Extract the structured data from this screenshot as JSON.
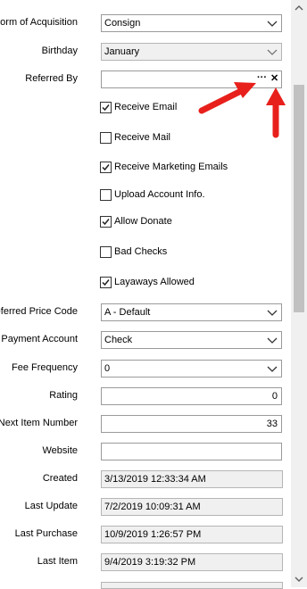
{
  "form": {
    "acquisition": {
      "label": "Form of Acquisition",
      "value": "Consign"
    },
    "birthday": {
      "label": "Birthday",
      "value": "January"
    },
    "referred_by": {
      "label": "Referred By",
      "value": "",
      "browse_label": "···",
      "clear_label": "✕"
    },
    "checkboxes": [
      {
        "label": "Receive Email",
        "checked": true
      },
      {
        "label": "Receive Mail",
        "checked": false
      },
      {
        "label": "Receive Marketing Emails",
        "checked": true
      },
      {
        "label": "Upload Account Info.",
        "checked": false
      },
      {
        "label": "Allow Donate",
        "checked": true
      },
      {
        "label": "Bad Checks",
        "checked": false
      },
      {
        "label": "Layaways Allowed",
        "checked": true
      }
    ],
    "preferred_price_code": {
      "label": "Preferred Price Code",
      "value": "A - Default"
    },
    "payment_account": {
      "label": "Payment Account",
      "value": "Check"
    },
    "fee_frequency": {
      "label": "Fee Frequency",
      "value": "0"
    },
    "rating": {
      "label": "Rating",
      "value": "0"
    },
    "next_item_number": {
      "label": "Next Item Number",
      "value": "33"
    },
    "website": {
      "label": "Website",
      "value": ""
    },
    "created": {
      "label": "Created",
      "value": "3/13/2019 12:33:34 AM"
    },
    "last_update": {
      "label": "Last Update",
      "value": "7/2/2019 10:09:31 AM"
    },
    "last_purchase": {
      "label": "Last Purchase",
      "value": "10/9/2019 1:26:57 PM"
    },
    "last_item": {
      "label": "Last Item",
      "value": "9/4/2019 3:19:32 PM"
    }
  },
  "colors": {
    "annotation_arrow": "#e8201c",
    "scrollbar_thumb": "#c1c1c1"
  }
}
